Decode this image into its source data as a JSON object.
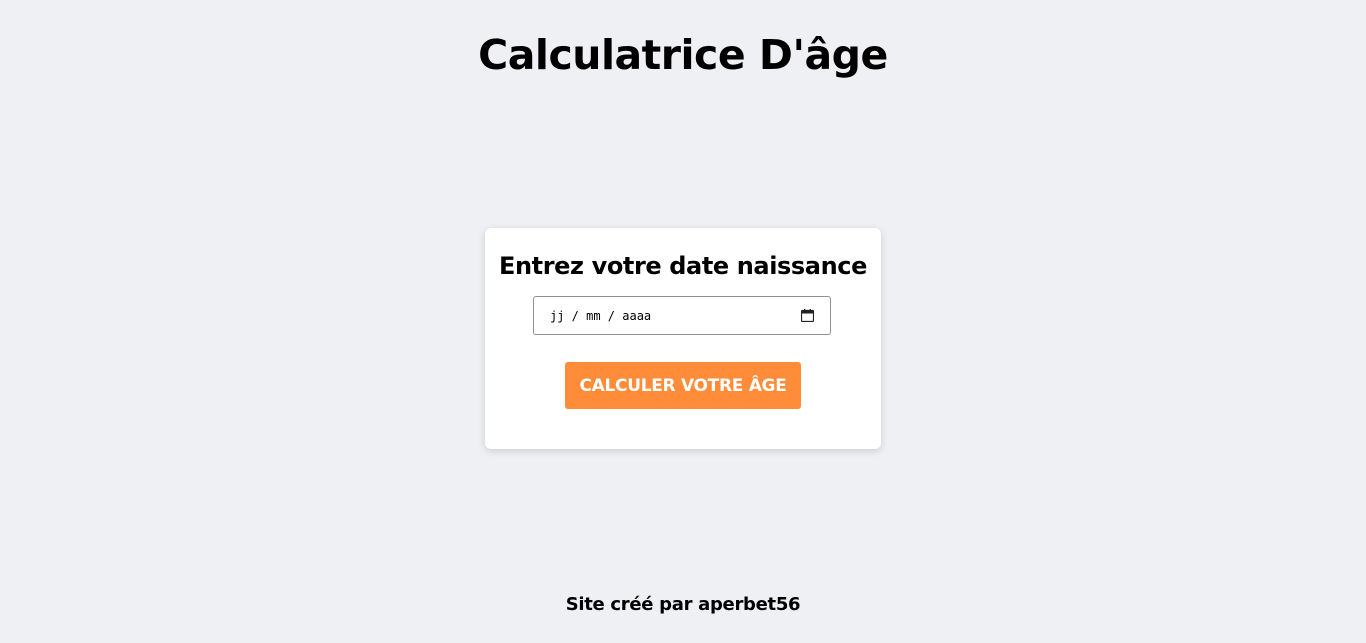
{
  "page": {
    "title": "Calculatrice D'âge",
    "background_color": "#eff0f4"
  },
  "form": {
    "heading": "Entrez votre date naissance",
    "date_input": {
      "placeholder_display": "jj / mm / aaaa",
      "icon": "calendar-icon"
    },
    "submit_label": "CALCULER VOTRE ÂGE",
    "button_color": "#fe8c38"
  },
  "footer": {
    "credit": "Site créé par aperbet56"
  }
}
